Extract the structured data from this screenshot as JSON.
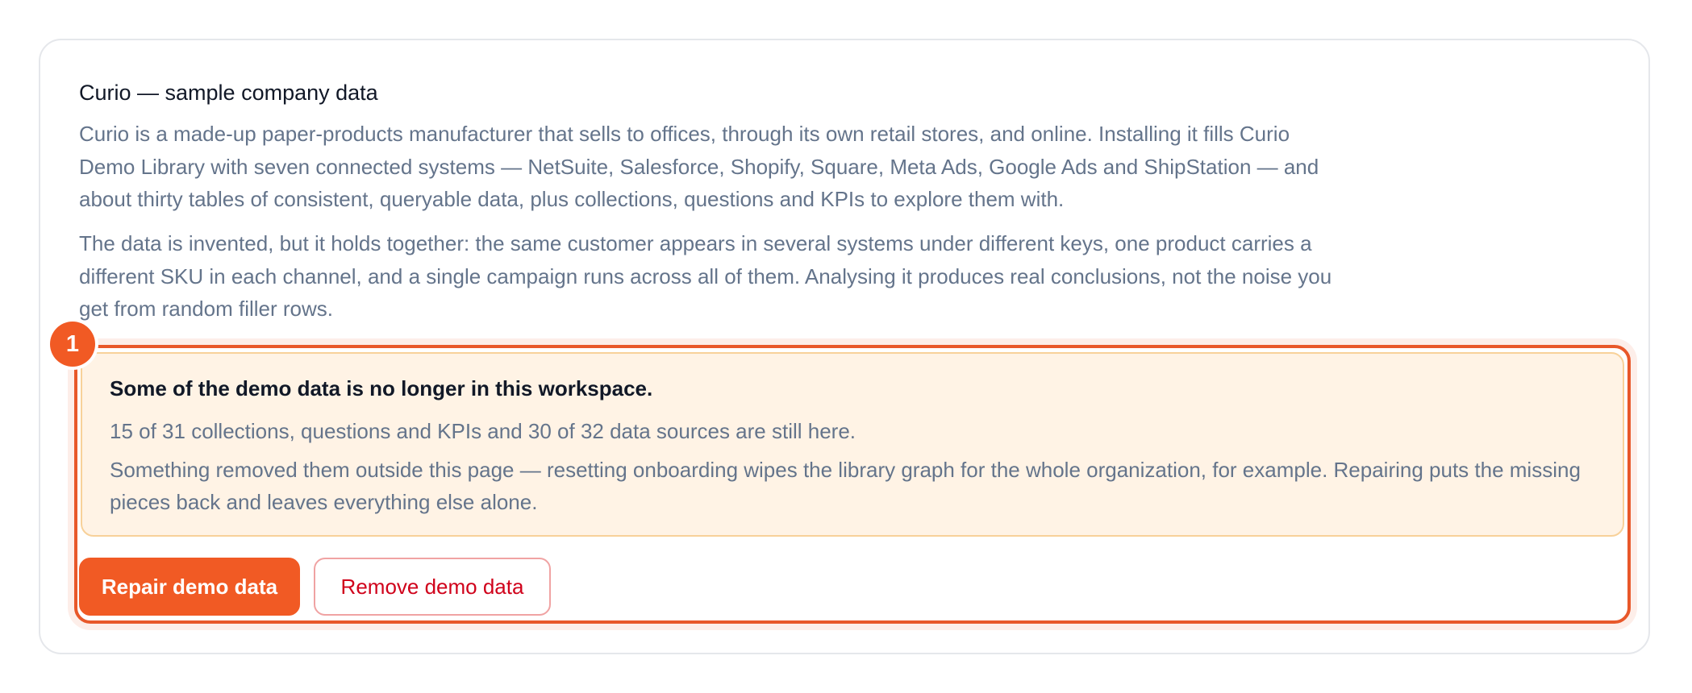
{
  "card": {
    "title": "Curio — sample company data",
    "intro_paragraph_1": "Curio is a made-up paper-products manufacturer that sells to offices, through its own retail stores, and online. Installing it fills Curio Demo Library with seven connected systems — NetSuite, Salesforce, Shopify, Square, Meta Ads, Google Ads and ShipStation — and about thirty tables of consistent, queryable data, plus collections, questions and KPIs to explore them with.",
    "intro_paragraph_2": "The data is invented, but it holds together: the same customer appears in several systems under different keys, one product carries a different SKU in each channel, and a single campaign runs across all of them. Analysing it produces real conclusions, not the noise you get from random filler rows."
  },
  "highlight": {
    "badge_number": "1"
  },
  "notice": {
    "title": "Some of the demo data is no longer in this workspace.",
    "status": "15 of 31 collections, questions and KPIs and 30 of 32 data sources are still here.",
    "explanation": "Something removed them outside this page — resetting onboarding wipes the library graph for the whole organization, for example. Repairing puts the missing pieces back and leaves everything else alone."
  },
  "actions": {
    "repair_label": "Repair demo data",
    "remove_label": "Remove demo data"
  },
  "colors": {
    "accent": "#f15a24",
    "notice_background": "#fff3e5",
    "notice_border": "#f8d199",
    "danger_text": "#d0021b"
  }
}
